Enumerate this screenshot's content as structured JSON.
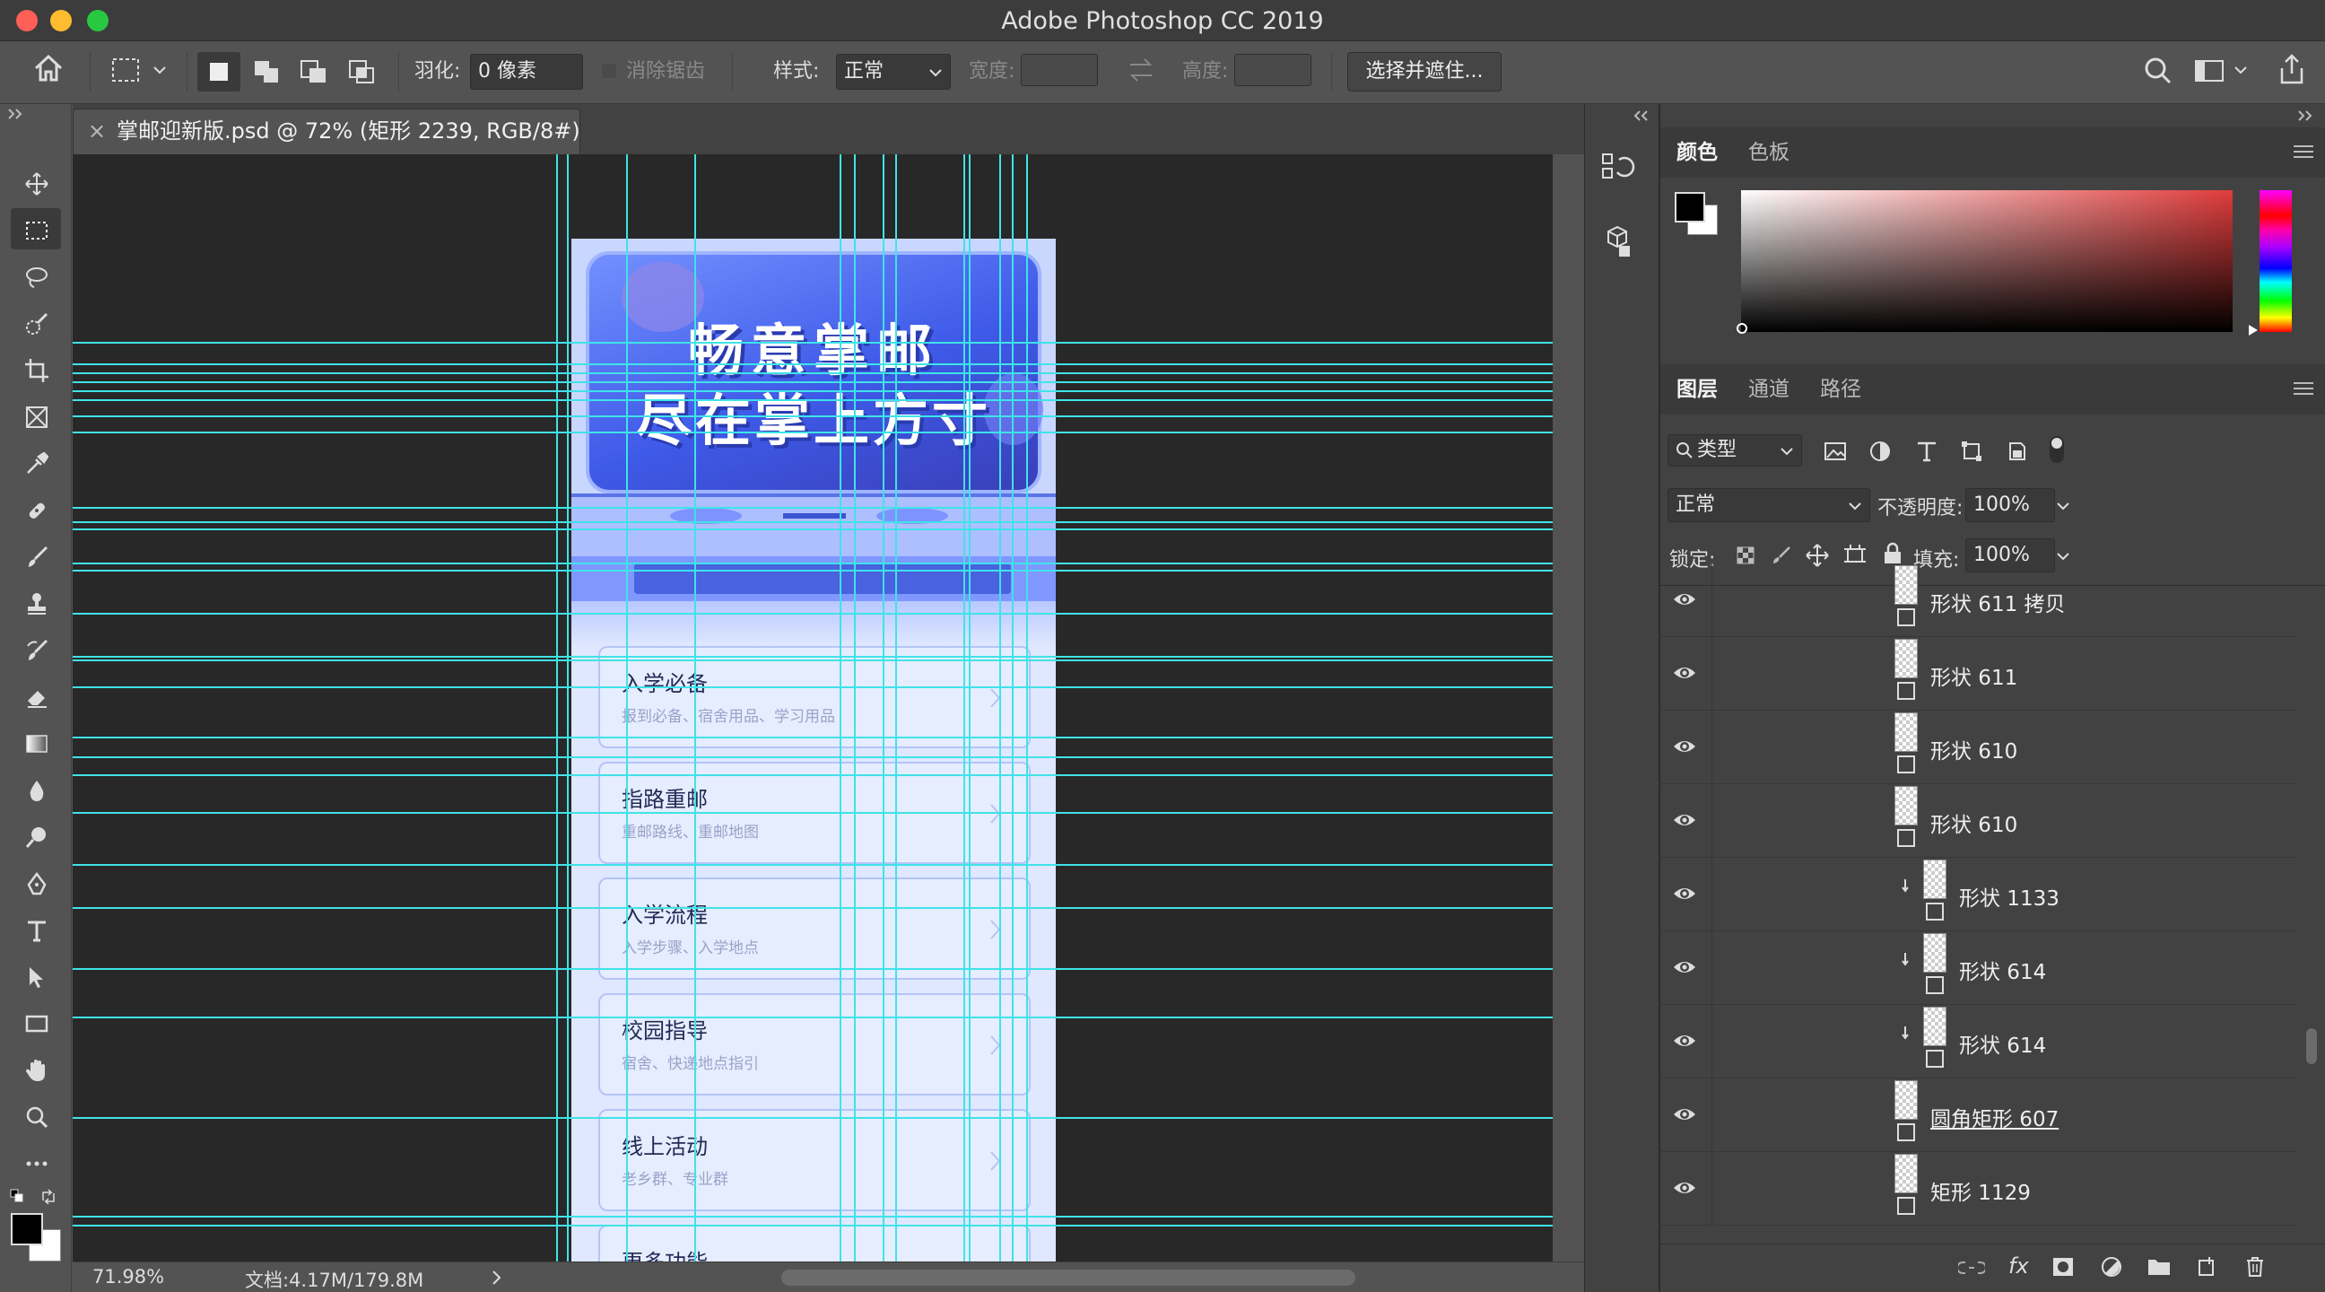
{
  "window": {
    "title": "Adobe Photoshop CC 2019"
  },
  "options": {
    "feather_label": "羽化:",
    "feather_value": "0 像素",
    "antialias_label": "消除锯齿",
    "style_label": "样式:",
    "style_value": "正常",
    "width_label": "宽度:",
    "height_label": "高度:",
    "select_mask_button": "选择并遮住..."
  },
  "document": {
    "tab_title": "掌邮迎新版.psd @ 72% (矩形 2239, RGB/8#)",
    "zoom": "71.98%",
    "doc_size": "文档:4.17M/179.8M"
  },
  "mockup": {
    "banner_line1": "畅意掌邮",
    "banner_line2": "尽在掌上方寸",
    "cards": [
      {
        "title": "入学必备",
        "subtitle": "报到必备、宿舍用品、学习用品"
      },
      {
        "title": "指路重邮",
        "subtitle": "重邮路线、重邮地图"
      },
      {
        "title": "入学流程",
        "subtitle": "入学步骤、入学地点"
      },
      {
        "title": "校园指导",
        "subtitle": "宿舍、快递地点指引"
      },
      {
        "title": "线上活动",
        "subtitle": "老乡群、专业群"
      },
      {
        "title": "更多功能",
        "subtitle": ""
      }
    ]
  },
  "color_panel": {
    "tabs": [
      "颜色",
      "色板"
    ],
    "active_tab": "颜色",
    "foreground": "#000000",
    "background": "#ffffff",
    "picker_hue": "#e03c3c"
  },
  "layers_panel": {
    "tabs": [
      "图层",
      "通道",
      "路径"
    ],
    "active_tab": "图层",
    "filter_kind": "类型",
    "blend_mode": "正常",
    "opacity_label": "不透明度:",
    "opacity_value": "100%",
    "lock_label": "锁定:",
    "fill_label": "填充:",
    "fill_value": "100%",
    "layers": [
      {
        "name": "形状 611 拷贝",
        "clipped": false
      },
      {
        "name": "形状 611",
        "clipped": false
      },
      {
        "name": "形状 610",
        "clipped": false
      },
      {
        "name": "形状 610",
        "clipped": false
      },
      {
        "name": "形状 1133",
        "clipped": true
      },
      {
        "name": "形状 614",
        "clipped": true
      },
      {
        "name": "形状 614",
        "clipped": true
      },
      {
        "name": "圆角矩形 607",
        "clipped": false,
        "underline": true
      },
      {
        "name": "矩形 1129",
        "clipped": false
      }
    ]
  },
  "colors": {
    "guide": "#3fe3e8",
    "accent_blue": "#4d6cff",
    "card_bg": "#dfe8ff"
  }
}
